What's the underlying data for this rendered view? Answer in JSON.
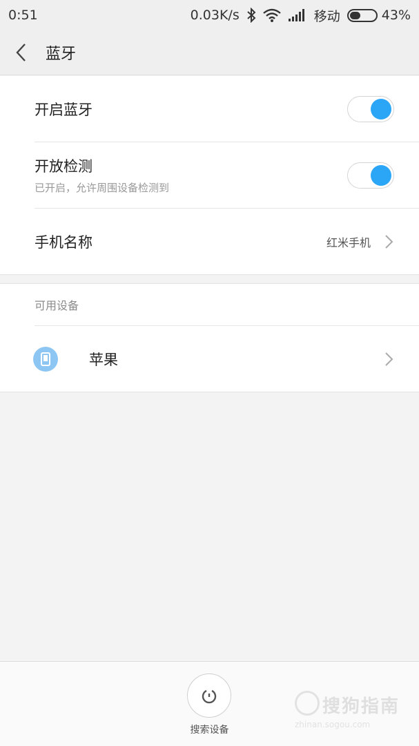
{
  "status_bar": {
    "time": "0:51",
    "net_speed": "0.03K/s",
    "carrier": "移动",
    "battery": "43%",
    "battery_level": 0.43
  },
  "header": {
    "title": "蓝牙"
  },
  "settings": {
    "bluetooth": {
      "label": "开启蓝牙",
      "on": true
    },
    "discoverable": {
      "label": "开放检测",
      "sub": "已开启，允许周围设备检测到",
      "on": true
    },
    "device_name": {
      "label": "手机名称",
      "value": "红米手机"
    }
  },
  "devices": {
    "section_label": "可用设备",
    "items": [
      {
        "name": "苹果",
        "icon": "phone-icon"
      }
    ]
  },
  "bottom": {
    "search_label": "搜索设备"
  },
  "watermark": {
    "title": "搜狗指南",
    "sub": "zhinan.sogou.com"
  },
  "colors": {
    "accent": "#2ba6f7",
    "device_icon_bg": "#8dc6f2"
  }
}
